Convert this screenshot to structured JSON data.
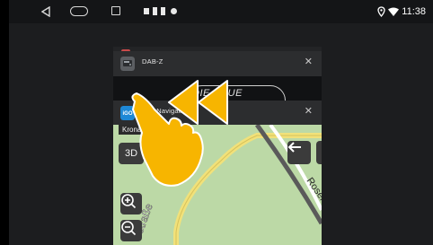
{
  "status_bar": {
    "time": "11:38",
    "nav_icons": [
      "back-icon",
      "home-icon",
      "recents-icon"
    ],
    "notification_icons": [
      "notification-icon",
      "sd-card-icon",
      "sd-card-icon",
      "record-icon"
    ],
    "status_icons": [
      "location-icon",
      "wifi-icon"
    ]
  },
  "recents": {
    "cards": [
      {
        "title": "DAB-Z",
        "icon": "dab-z-app-icon",
        "close_label": "✕",
        "body_text": "DIE NEUE"
      },
      {
        "title": "iGO Navigation",
        "icon": "igo-navigation-app-icon",
        "close_label": "✕"
      }
    ]
  },
  "igo_map": {
    "location_text": "Kronau (Karlsruhe)",
    "view_mode_button": "3D",
    "street_label_1": "ostraße",
    "street_label_2": "Rosensti",
    "icons": [
      "back-arrow-icon",
      "zoom-in-icon",
      "zoom-out-icon"
    ]
  },
  "hint_overlay": {
    "icons": [
      "swipe-left-arrows-icon",
      "hand-pointer-icon"
    ],
    "colors": {
      "hint": "#f7b500",
      "hint_outline": "#ffffff"
    }
  },
  "colors": {
    "background": "#1c1d1f",
    "map_green": "#bcd9a6",
    "road_yellow": "#f1e17a"
  }
}
